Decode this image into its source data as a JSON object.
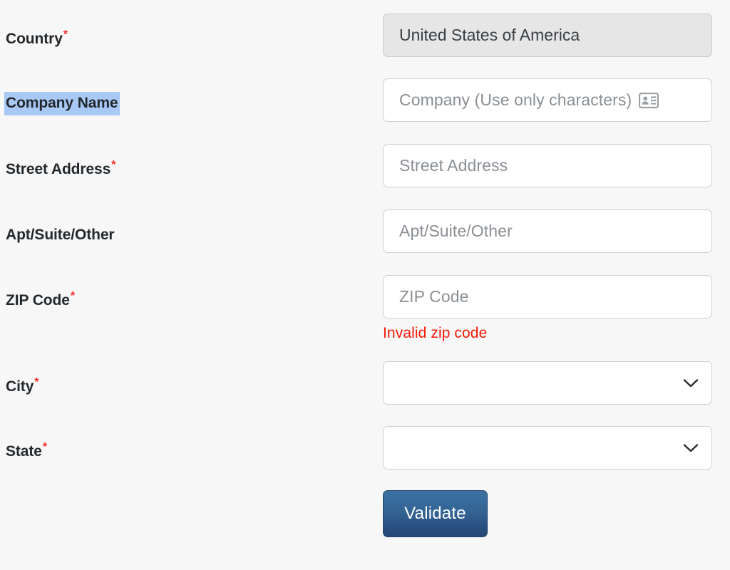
{
  "form": {
    "selection_highlight_color": "#a8c8f5",
    "required_marker": "*",
    "fields": [
      {
        "label": "Country",
        "required": true,
        "type": "text",
        "value": "United States of America",
        "placeholder": "",
        "disabled": true
      },
      {
        "label": "Company Name",
        "required": false,
        "type": "text",
        "value": "",
        "placeholder": "Company (Use only characters)",
        "icon": "id-card-icon",
        "label_selected": true
      },
      {
        "label": "Street Address",
        "required": true,
        "type": "text",
        "value": "",
        "placeholder": "Street Address"
      },
      {
        "label": "Apt/Suite/Other",
        "required": false,
        "type": "text",
        "value": "",
        "placeholder": "Apt/Suite/Other"
      },
      {
        "label": "ZIP Code",
        "required": true,
        "type": "text",
        "value": "",
        "placeholder": "ZIP Code",
        "error": "Invalid zip code",
        "error_color": "#fa1707"
      },
      {
        "label": "City",
        "required": true,
        "type": "select",
        "value": "",
        "icon": "chevron-down-icon"
      },
      {
        "label": "State",
        "required": true,
        "type": "select",
        "value": "",
        "icon": "chevron-down-icon"
      }
    ],
    "submit": {
      "label": "Validate",
      "color": "#2f5e8c"
    }
  }
}
